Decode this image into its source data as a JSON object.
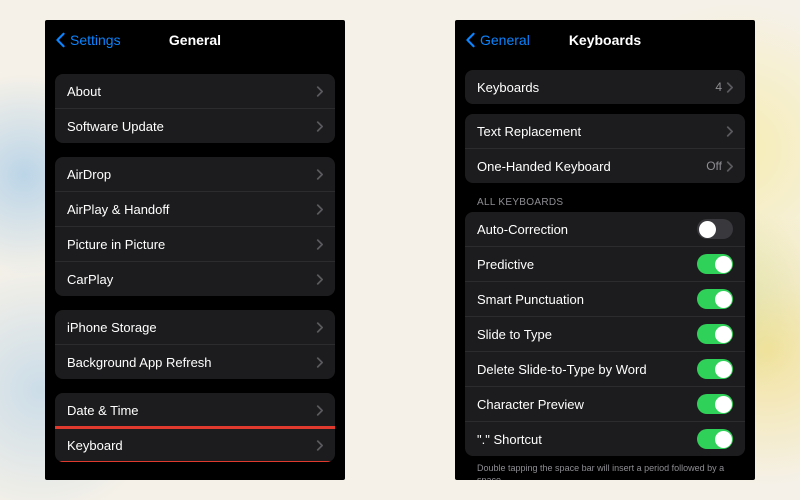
{
  "left": {
    "back": "Settings",
    "title": "General",
    "g1": [
      "About",
      "Software Update"
    ],
    "g2": [
      "AirDrop",
      "AirPlay & Handoff",
      "Picture in Picture",
      "CarPlay"
    ],
    "g3": [
      "iPhone Storage",
      "Background App Refresh"
    ],
    "g4": [
      "Date & Time",
      "Keyboard"
    ]
  },
  "right": {
    "back": "General",
    "title": "Keyboards",
    "keyboards": {
      "label": "Keyboards",
      "value": "4"
    },
    "g2": [
      {
        "label": "Text Replacement"
      },
      {
        "label": "One-Handed Keyboard",
        "value": "Off"
      }
    ],
    "section": "All Keyboards",
    "toggles": [
      {
        "label": "Auto-Correction",
        "on": false
      },
      {
        "label": "Predictive",
        "on": true
      },
      {
        "label": "Smart Punctuation",
        "on": true
      },
      {
        "label": "Slide to Type",
        "on": true
      },
      {
        "label": "Delete Slide-to-Type by Word",
        "on": true
      },
      {
        "label": "Character Preview",
        "on": true
      },
      {
        "label": "\".\" Shortcut",
        "on": true
      }
    ],
    "footer": "Double tapping the space bar will insert a period followed by a space."
  }
}
